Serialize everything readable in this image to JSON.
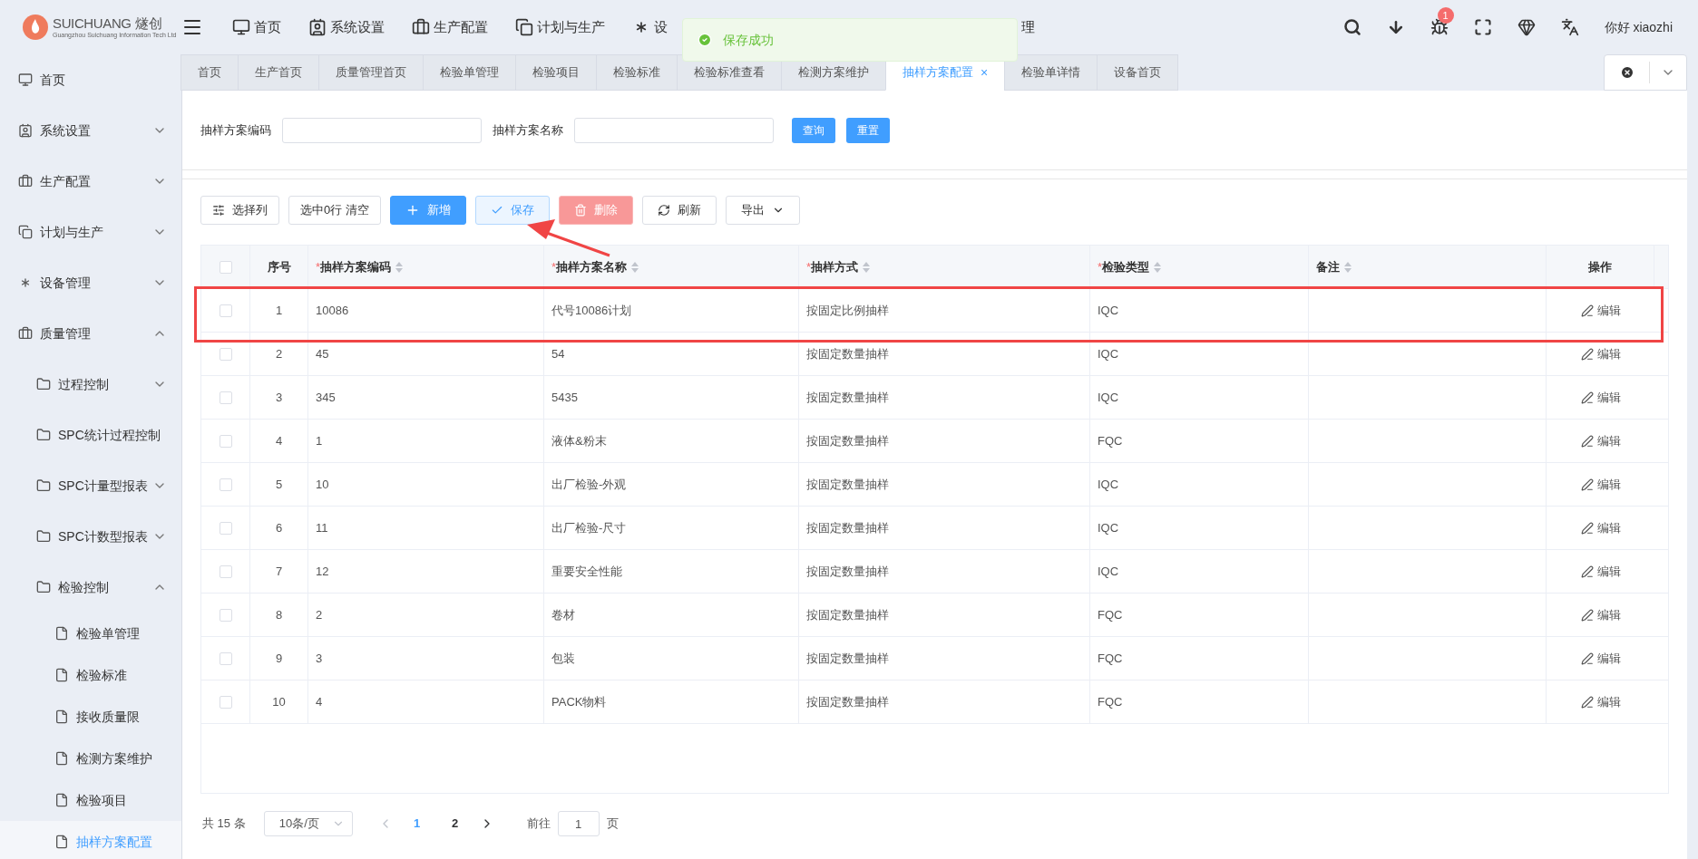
{
  "logo": {
    "brand": "SUICHUANG",
    "brand_cn": "燧创",
    "tagline": "Guangzhou Suichuang Information Tech Ltd"
  },
  "topnav": [
    {
      "label": "首页"
    },
    {
      "label": "系统设置"
    },
    {
      "label": "生产配置"
    },
    {
      "label": "计划与生产"
    },
    {
      "label": "设"
    },
    {
      "label": "理"
    }
  ],
  "toast": {
    "message": "保存成功"
  },
  "header": {
    "badge": "1",
    "user": "你好 xiaozhi"
  },
  "sidebar": [
    {
      "label": "首页"
    },
    {
      "label": "系统设置",
      "expanded": false
    },
    {
      "label": "生产配置",
      "expanded": false
    },
    {
      "label": "计划与生产",
      "expanded": false
    },
    {
      "label": "设备管理",
      "expanded": false
    },
    {
      "label": "质量管理",
      "expanded": true,
      "children": [
        {
          "label": "过程控制",
          "expanded": false
        },
        {
          "label": "SPC统计过程控制"
        },
        {
          "label": "SPC计量型报表",
          "expanded": false
        },
        {
          "label": "SPC计数型报表",
          "expanded": false
        },
        {
          "label": "检验控制",
          "expanded": true,
          "children": [
            {
              "label": "检验单管理",
              "selected": false
            },
            {
              "label": "检验标准",
              "selected": false
            },
            {
              "label": "接收质量限",
              "selected": false
            },
            {
              "label": "检测方案维护",
              "selected": false
            },
            {
              "label": "检验项目",
              "selected": false
            },
            {
              "label": "抽样方案配置",
              "selected": true
            }
          ]
        }
      ]
    }
  ],
  "tabs": [
    {
      "label": "首页",
      "selected": false
    },
    {
      "label": "生产首页",
      "selected": false
    },
    {
      "label": "质量管理首页",
      "selected": false
    },
    {
      "label": "检验单管理",
      "selected": false
    },
    {
      "label": "检验项目",
      "selected": false
    },
    {
      "label": "检验标准",
      "selected": false
    },
    {
      "label": "检验标准查看",
      "selected": false
    },
    {
      "label": "检测方案维护",
      "selected": false
    },
    {
      "label": "抽样方案配置",
      "selected": true,
      "close": "×"
    },
    {
      "label": "检验单详情",
      "selected": false
    },
    {
      "label": "设备首页",
      "selected": false
    }
  ],
  "search": {
    "fields": [
      {
        "label": "抽样方案编码"
      },
      {
        "label": "抽样方案名称"
      }
    ],
    "buttons": [
      "查询",
      "重置"
    ]
  },
  "toolbar": [
    {
      "label": "选择列",
      "kind": "columns"
    },
    {
      "label": "选中0行 清空",
      "kind": "plain"
    },
    {
      "label": "新增",
      "kind": "add"
    },
    {
      "label": "保存",
      "kind": "save"
    },
    {
      "label": "删除",
      "kind": "delete"
    },
    {
      "label": "刷新",
      "kind": "refresh"
    },
    {
      "label": "导出",
      "kind": "export"
    }
  ],
  "table": {
    "select_all": {
      "checked": false
    },
    "columns": [
      {
        "label": "序号"
      },
      {
        "label": "抽样方案编码",
        "mark": "*",
        "sortable": true
      },
      {
        "label": "抽样方案名称",
        "mark": "*",
        "sortable": true
      },
      {
        "label": "抽样方式",
        "mark": "*",
        "sortable": true
      },
      {
        "label": "检验类型",
        "mark": "*",
        "sortable": true
      },
      {
        "label": "备注",
        "sortable": true
      },
      {
        "label": "操作"
      }
    ],
    "rows": [
      {
        "checked": false,
        "no": "1",
        "code": "10086",
        "name": "代号10086计划",
        "method": "按固定比例抽样",
        "type": "IQC",
        "action": "编辑"
      },
      {
        "checked": false,
        "no": "2",
        "code": "45",
        "name": "54",
        "method": "按固定数量抽样",
        "type": "IQC",
        "action": "编辑"
      },
      {
        "checked": false,
        "no": "3",
        "code": "345",
        "name": "5435",
        "method": "按固定数量抽样",
        "type": "IQC",
        "action": "编辑"
      },
      {
        "checked": false,
        "no": "4",
        "code": "1",
        "name": "液体&粉末",
        "method": "按固定数量抽样",
        "type": "FQC",
        "action": "编辑"
      },
      {
        "checked": false,
        "no": "5",
        "code": "10",
        "name": "出厂检验-外观",
        "method": "按固定数量抽样",
        "type": "IQC",
        "action": "编辑"
      },
      {
        "checked": false,
        "no": "6",
        "code": "11",
        "name": "出厂检验-尺寸",
        "method": "按固定数量抽样",
        "type": "IQC",
        "action": "编辑"
      },
      {
        "checked": false,
        "no": "7",
        "code": "12",
        "name": "重要安全性能",
        "method": "按固定数量抽样",
        "type": "IQC",
        "action": "编辑"
      },
      {
        "checked": false,
        "no": "8",
        "code": "2",
        "name": "卷材",
        "method": "按固定数量抽样",
        "type": "FQC",
        "action": "编辑"
      },
      {
        "checked": false,
        "no": "9",
        "code": "3",
        "name": "包装",
        "method": "按固定数量抽样",
        "type": "FQC",
        "action": "编辑"
      },
      {
        "checked": false,
        "no": "10",
        "code": "4",
        "name": "PACK物料",
        "method": "按固定数量抽样",
        "type": "FQC",
        "action": "编辑"
      }
    ]
  },
  "pagination": {
    "total": "共 15 条",
    "page_size": "10条/页",
    "pages": [
      {
        "label": "1",
        "selected": true
      },
      {
        "label": "2",
        "selected": false
      }
    ],
    "goto_label": "前往",
    "goto_value": "1",
    "page_suffix": "页"
  }
}
